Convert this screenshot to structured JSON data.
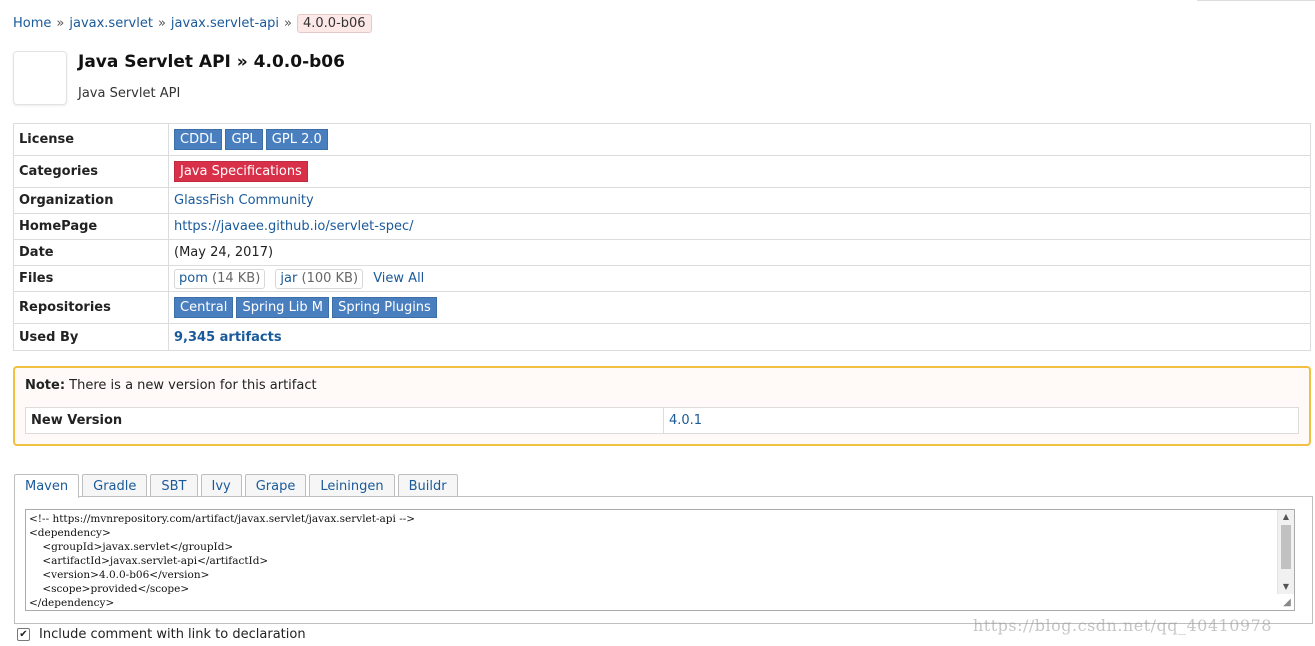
{
  "breadcrumb": {
    "items": [
      "Home",
      "javax.servlet",
      "javax.servlet-api"
    ],
    "separator": "»",
    "current": "4.0.0-b06"
  },
  "header": {
    "title": "Java Servlet API » 4.0.0-b06",
    "subtitle": "Java Servlet API"
  },
  "info": {
    "license_label": "License",
    "licenses": [
      "CDDL",
      "GPL",
      "GPL 2.0"
    ],
    "categories_label": "Categories",
    "categories": [
      "Java Specifications"
    ],
    "organization_label": "Organization",
    "organization": "GlassFish Community",
    "homepage_label": "HomePage",
    "homepage": "https://javaee.github.io/servlet-spec/",
    "date_label": "Date",
    "date": "(May 24, 2017)",
    "files_label": "Files",
    "files": [
      {
        "name": "pom",
        "size": "(14 KB)"
      },
      {
        "name": "jar",
        "size": "(100 KB)"
      }
    ],
    "view_all": "View All",
    "repositories_label": "Repositories",
    "repositories": [
      "Central",
      "Spring Lib M",
      "Spring Plugins"
    ],
    "used_by_label": "Used By",
    "used_by": "9,345 artifacts"
  },
  "note": {
    "strong": "Note:",
    "text": " There is a new version for this artifact",
    "new_version_label": "New Version",
    "new_version": "4.0.1"
  },
  "tabs": [
    "Maven",
    "Gradle",
    "SBT",
    "Ivy",
    "Grape",
    "Leiningen",
    "Buildr"
  ],
  "code": "<!-- https://mvnrepository.com/artifact/javax.servlet/javax.servlet-api -->\n<dependency>\n    <groupId>javax.servlet</groupId>\n    <artifactId>javax.servlet-api</artifactId>\n    <version>4.0.0-b06</version>\n    <scope>provided</scope>\n</dependency>",
  "checkbox": {
    "label": "Include comment with link to declaration",
    "checked_glyph": "✔"
  },
  "watermark": "https://blog.csdn.net/qq_40410978",
  "colors": {
    "license_badge": "#4a7fbf",
    "category_badge": "#d9304a",
    "note_border": "#f0c040",
    "link": "#1a5a9a"
  },
  "icons": {
    "scroll_up": "▲",
    "scroll_down": "▼",
    "resize_grip": "◢"
  }
}
